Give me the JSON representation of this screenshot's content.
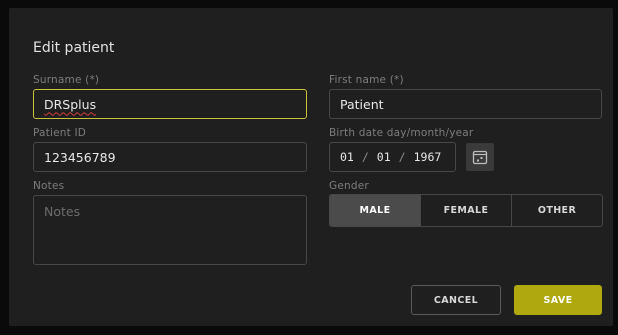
{
  "dialog": {
    "title": "Edit patient"
  },
  "fields": {
    "surname": {
      "label": "Surname (*)",
      "value": "DRSplus"
    },
    "first_name": {
      "label": "First name (*)",
      "value": "Patient"
    },
    "patient_id": {
      "label": "Patient ID",
      "value": "123456789"
    },
    "birth_date": {
      "label": "Birth date day/month/year",
      "day": "01",
      "month": "01",
      "year": "1967",
      "separator": "/"
    },
    "notes": {
      "label": "Notes",
      "placeholder": "Notes"
    },
    "gender": {
      "label": "Gender",
      "options": [
        "MALE",
        "FEMALE",
        "OTHER"
      ],
      "selected": "MALE"
    }
  },
  "actions": {
    "cancel_label": "CANCEL",
    "save_label": "SAVE"
  },
  "colors": {
    "accent": "#b0a80f",
    "focus_border": "#c9c23a",
    "dialog_bg": "#1f1f1f",
    "selected_segment": "#4b4b4b"
  },
  "icons": {
    "date_picker": "calendar-icon"
  }
}
